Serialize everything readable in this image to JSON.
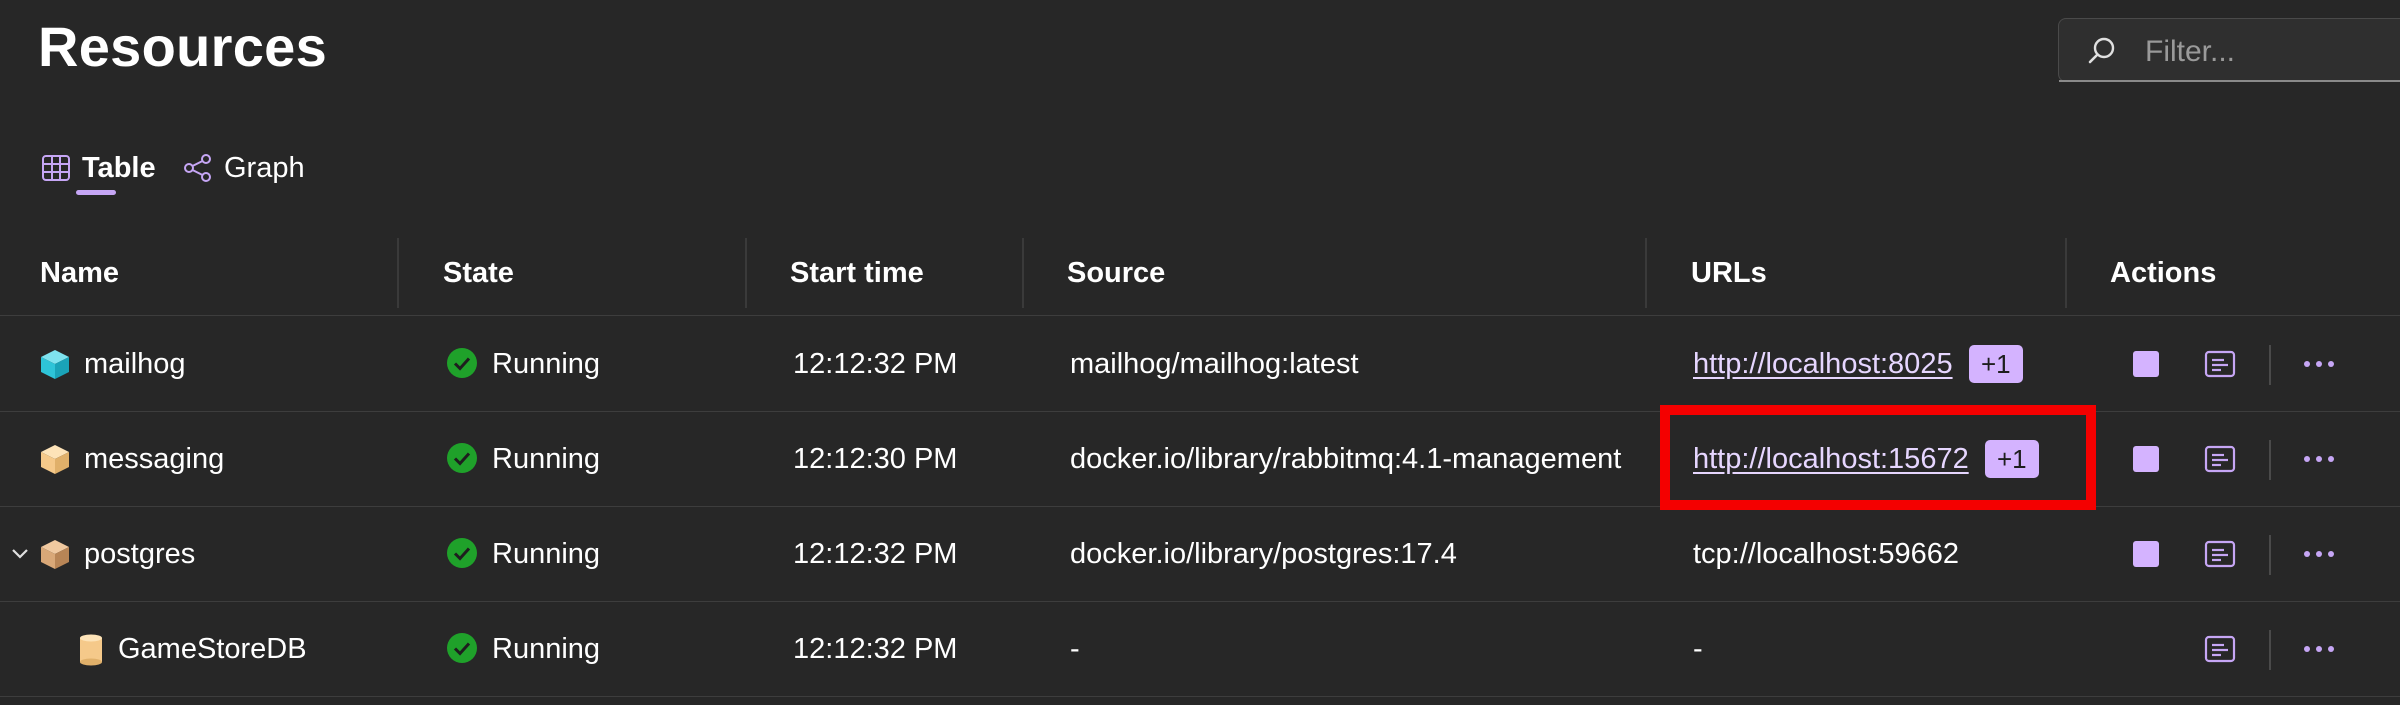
{
  "page": {
    "title": "Resources"
  },
  "filter": {
    "placeholder": "Filter..."
  },
  "tabs": [
    {
      "label": "Table",
      "icon": "table-icon",
      "active": true
    },
    {
      "label": "Graph",
      "icon": "graph-icon",
      "active": false
    }
  ],
  "columns": [
    "Name",
    "State",
    "Start time",
    "Source",
    "URLs",
    "Actions"
  ],
  "rows": [
    {
      "name": "mailhog",
      "icon": "container-icon",
      "icon_color": "#2ec4d8",
      "state": "Running",
      "start_time": "12:12:32 PM",
      "source": "mailhog/mailhog:latest",
      "url": "http://localhost:8025",
      "url_is_link": true,
      "url_badge": "+1"
    },
    {
      "name": "messaging",
      "icon": "container-icon",
      "icon_color": "#f5c98a",
      "state": "Running",
      "start_time": "12:12:30 PM",
      "source": "docker.io/library/rabbitmq:4.1-management",
      "url": "http://localhost:15672",
      "url_is_link": true,
      "url_badge": "+1"
    },
    {
      "name": "postgres",
      "icon": "container-icon",
      "icon_color": "#d9a878",
      "state": "Running",
      "start_time": "12:12:32 PM",
      "source": "docker.io/library/postgres:17.4",
      "url": "tcp://localhost:59662",
      "url_is_link": false,
      "url_badge": "",
      "expandable": true
    },
    {
      "name": "GameStoreDB",
      "icon": "database-icon",
      "icon_color": "#f5c98a",
      "state": "Running",
      "start_time": "12:12:32 PM",
      "source": "-",
      "url": "-",
      "url_is_link": false,
      "url_badge": "",
      "child": true
    }
  ],
  "colors": {
    "background": "#272727",
    "accent": "#d4b3ff",
    "running": "#1fa12a",
    "highlight": "#f40000"
  }
}
